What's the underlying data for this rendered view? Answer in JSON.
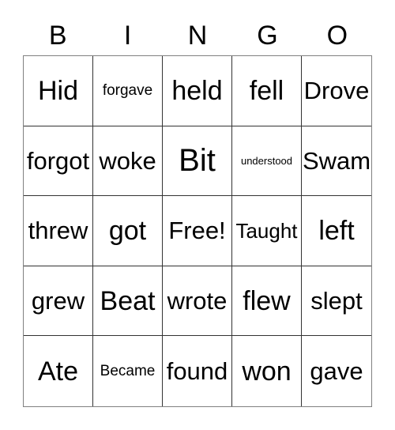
{
  "card": {
    "title": "BINGO",
    "header_letters": [
      "B",
      "I",
      "N",
      "G",
      "O"
    ],
    "grid_size": "5x5",
    "free_space": "Free!",
    "rows": [
      [
        {
          "label": "Hid",
          "size": "fs-lg"
        },
        {
          "label": "forgave",
          "size": "fs-xs"
        },
        {
          "label": "held",
          "size": "fs-lg"
        },
        {
          "label": "fell",
          "size": "fs-lg"
        },
        {
          "label": "Drove",
          "size": "fs-md"
        }
      ],
      [
        {
          "label": "forgot",
          "size": "fs-md"
        },
        {
          "label": "woke",
          "size": "fs-md"
        },
        {
          "label": "Bit",
          "size": "fs-xl"
        },
        {
          "label": "understood",
          "size": "fs-xxs"
        },
        {
          "label": "Swam",
          "size": "fs-md"
        }
      ],
      [
        {
          "label": "threw",
          "size": "fs-md"
        },
        {
          "label": "got",
          "size": "fs-lg"
        },
        {
          "label": "Free!",
          "size": "fs-md"
        },
        {
          "label": "Taught",
          "size": "fs-sm"
        },
        {
          "label": "left",
          "size": "fs-lg"
        }
      ],
      [
        {
          "label": "grew",
          "size": "fs-md"
        },
        {
          "label": "Beat",
          "size": "fs-lg"
        },
        {
          "label": "wrote",
          "size": "fs-md"
        },
        {
          "label": "flew",
          "size": "fs-lg"
        },
        {
          "label": "slept",
          "size": "fs-md"
        }
      ],
      [
        {
          "label": "Ate",
          "size": "fs-lg"
        },
        {
          "label": "Became",
          "size": "fs-xs"
        },
        {
          "label": "found",
          "size": "fs-md"
        },
        {
          "label": "won",
          "size": "fs-lg"
        },
        {
          "label": "gave",
          "size": "fs-md"
        }
      ]
    ]
  },
  "colors": {
    "background": "#ffffff",
    "text": "#000000",
    "grid_line": "#333333",
    "grid_outer": "#808080"
  }
}
